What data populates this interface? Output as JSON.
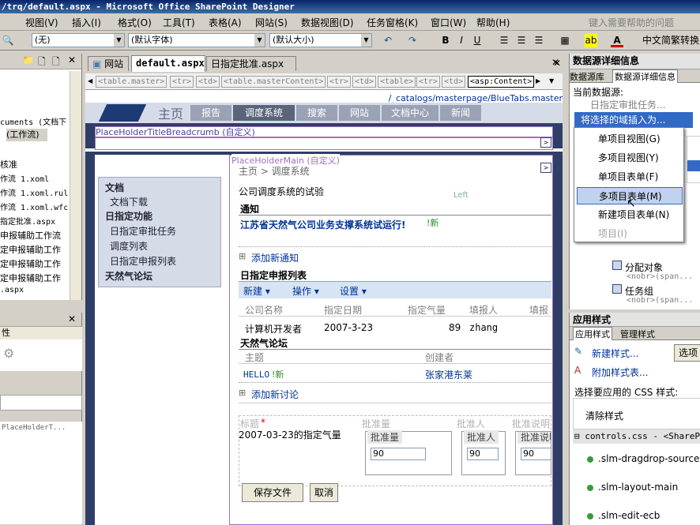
{
  "window": {
    "title": "/trq/default.aspx - Microsoft Office SharePoint Designer"
  },
  "menu": [
    "视图(V)",
    "插入(I)",
    "格式(O)",
    "工具(T)",
    "表格(A)",
    "网站(S)",
    "数据视图(D)",
    "任务窗格(K)",
    "窗口(W)",
    "帮助(H)"
  ],
  "menu_help_placeholder": "键入需要帮助的问题",
  "toolbar": {
    "style": "(无)",
    "font": "(默认字体)",
    "size": "(默认大小)",
    "bold": "B",
    "italic": "I",
    "underline": "U",
    "ime": "中文简繁转换"
  },
  "left_top_panel": {
    "items": [
      "cuments (文档下",
      "(工作流)",
      "核准",
      "作流 1.xoml",
      "作流 1.xoml.rul",
      "作流 1.xoml.wfc",
      "指定批准.aspx",
      "申报辅助工作流",
      "定申报辅助工作",
      "定申报辅助工作",
      "定申报辅助工作",
      "定申报辅助工作",
      ".aspx"
    ]
  },
  "left_bottom_panel": {
    "header": "性",
    "field": "PlaceHolderT..."
  },
  "tabs": [
    "网站",
    "default.aspx",
    "日指定批准.aspx"
  ],
  "crumbs": [
    "<table.master>",
    "<tr>",
    "<td>",
    "<table.masterContent>",
    "<tr>",
    "<td>",
    "<table>",
    "<tr>",
    "<td>",
    "<asp:Content>"
  ],
  "masterpage_path": "/_catalogs/masterpage/BlueTabs.master",
  "site": {
    "home": "主页",
    "nav": [
      "报告",
      "调度系统",
      "搜索",
      "网站",
      "文档中心",
      "新闻"
    ]
  },
  "placeholders": {
    "breadcrumb": "PlaceHolderTitleBreadcrumb (自定义)",
    "main": "PlaceHolderMain (自定义)"
  },
  "quicklaunch": {
    "doc_header": "文档",
    "doc_items": [
      "文档下载"
    ],
    "func_header": "日指定功能",
    "func_items": [
      "日指定审批任务",
      "调度列表",
      "日指定申报列表"
    ],
    "forum": "天然气论坛"
  },
  "page": {
    "breadcrumb": "主页 > 调度系统",
    "desc": "公司调度系统的试验",
    "left_label": "Left",
    "notice_title": "通知",
    "notice_item": "江苏省天然气公司业务支撑系统试运行!",
    "new_tag": "!新",
    "add_notice": "添加新通知",
    "list_title": "日指定申报列表",
    "list_toolbar": [
      "新建 ▾",
      "操作 ▾",
      "设置 ▾"
    ],
    "list_headers": [
      "公司名称",
      "指定日期",
      "指定气量",
      "填报人",
      "填报"
    ],
    "list_row": [
      "计算机开发者",
      "2007-3-23",
      "89",
      "zhang"
    ],
    "forum_title": "天然气论坛",
    "forum_headers": [
      "主题",
      "创建者"
    ],
    "forum_row": [
      "HELLO",
      "张家港东莱"
    ],
    "add_forum": "添加新讨论"
  },
  "form": {
    "headers": [
      "标题",
      "批准量",
      "批准人",
      "批准说明"
    ],
    "required_mark": "*",
    "title_value": "2007-03-23的指定气量",
    "field_labels": [
      "批准量",
      "批准人",
      "批准说明"
    ],
    "values": [
      "90",
      "90",
      "90"
    ],
    "save": "保存文件",
    "cancel": "取消"
  },
  "right_top": {
    "header": "数据源详细信息",
    "tabs": [
      "数据源库",
      "数据源详细信息"
    ],
    "current_label": "当前数据源:",
    "current_value": "日指定审批任务...",
    "insert_btn": "将选择的域插入为...",
    "menu_items": [
      "单项目视图(G)",
      "多项目视图(Y)",
      "单项目表单(F)",
      "多项目表单(M)",
      "新建项目表单(N)",
      "项目(I)"
    ],
    "tree_items": [
      "分配对象",
      "<nobr>(span...",
      "任务组",
      "<nobr>(span..."
    ]
  },
  "right_bottom": {
    "header": "应用样式",
    "tabs": [
      "应用样式",
      "管理样式"
    ],
    "new_style": "新建样式...",
    "attach_style": "附加样式表...",
    "options": "选项",
    "select_label": "选择要应用的 CSS 样式:",
    "clear": "清除样式",
    "css_file": "controls.css - <SharePoi",
    "styles": [
      ".slm-dragdrop-source",
      ".slm-layout-main",
      ".slm-edit-ecb"
    ]
  }
}
